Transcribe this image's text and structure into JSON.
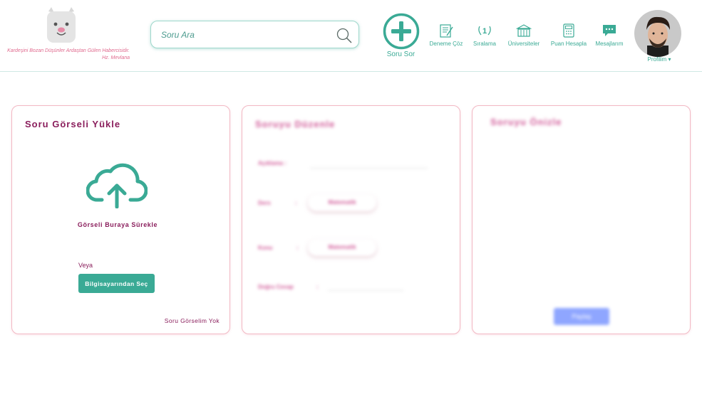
{
  "header": {
    "tagline": "Kardeşini Bozan Düşünler Ardaştan Gülen Habercisidir. Hz. Mevlana",
    "search_placeholder": "Soru Ara",
    "ask_label": "Soru Sor",
    "nav": [
      {
        "label": "Deneme Çöz",
        "icon": "exam-icon"
      },
      {
        "label": "Sıralama",
        "icon": "ranking-icon"
      },
      {
        "label": "Üniversiteler",
        "icon": "university-icon"
      },
      {
        "label": "Puan Hesapla",
        "icon": "calculator-icon"
      },
      {
        "label": "Mesajlarım",
        "icon": "message-icon"
      }
    ],
    "profile_label": "Profilim ▾"
  },
  "upload_card": {
    "title": "Soru Görseli Yükle",
    "drop_label": "Görseli Buraya Sürekle",
    "or_label": "Veya",
    "pick_button": "Bilgisayarından Seç",
    "status": "Soru Görselim Yok"
  },
  "edit_card": {
    "title": "Soruyu Düzenle",
    "description_label": "Açıklama :",
    "lesson_label": "Ders",
    "lesson_value": "Matematik",
    "topic_label": "Konu",
    "topic_value": "Matematik",
    "answer_label": "Doğru Cevap"
  },
  "preview_card": {
    "title": "Soruyu Önizle",
    "share_button": "Paylaş"
  },
  "colors": {
    "accent": "#3aaa95",
    "title": "#8a1e5c",
    "card_border": "#f2b9c4",
    "preview_button": "#8fa6ff"
  }
}
